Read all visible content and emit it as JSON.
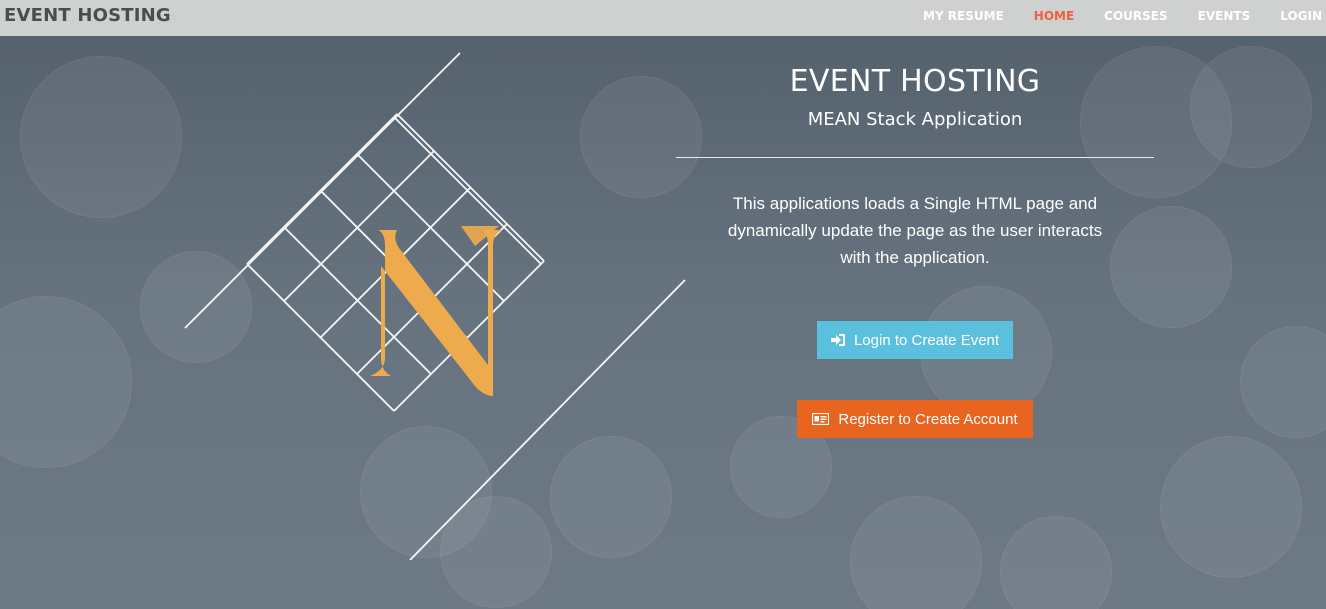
{
  "navbar": {
    "brand": "EVENT HOSTING",
    "links": [
      {
        "label": "MY RESUME",
        "active": false
      },
      {
        "label": "HOME",
        "active": true
      },
      {
        "label": "COURSES",
        "active": false
      },
      {
        "label": "EVENTS",
        "active": false
      },
      {
        "label": "LOGIN",
        "active": false
      }
    ]
  },
  "hero": {
    "title": "EVENT HOSTING",
    "subtitle": "MEAN Stack Application",
    "description": "This applications loads a Single HTML page and dynamically update the page as the user interacts with the application.",
    "login_button": {
      "label": "Login to Create Event",
      "icon": "sign-in-icon"
    },
    "register_button": {
      "label": "Register to Create Account",
      "icon": "id-card-icon"
    }
  },
  "colors": {
    "nav_background": "#cfd0d0",
    "nav_active": "#f05f40",
    "login_button": "#5bc0de",
    "register_button": "#e8641f",
    "logo_gold": "#eeab4d"
  }
}
